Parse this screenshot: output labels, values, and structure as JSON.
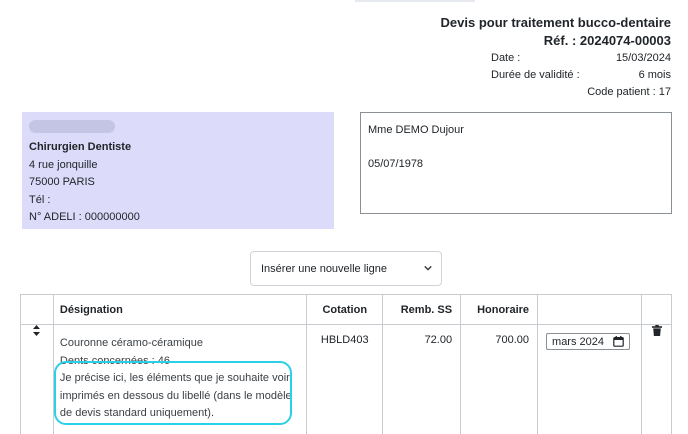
{
  "header": {
    "title": "Devis pour traitement bucco-dentaire",
    "ref": "Réf. : 2024074-00003",
    "date_label": "Date :",
    "date_value": "15/03/2024",
    "validity_label": "Durée de validité :",
    "validity_value": "6 mois",
    "patient_code": "Code patient : 17"
  },
  "practitioner": {
    "title": "Chirurgien Dentiste",
    "address1": "4 rue jonquille",
    "address2": "75000 PARIS",
    "phone": "Tél :",
    "adeli": "N° ADELI : 000000000"
  },
  "patient": {
    "name": "Mme DEMO Dujour",
    "birthdate": "05/07/1978"
  },
  "insert_select": {
    "selected": "Insérer une nouvelle ligne"
  },
  "table": {
    "headers": {
      "designation": "Désignation",
      "cotation": "Cotation",
      "remb": "Remb. SS",
      "honoraire": "Honoraire"
    },
    "rows": [
      {
        "label": "Couronne céramo-céramique",
        "teeth": "Dents concernées : 46",
        "note_1": "Je précise ici, les éléments que je souhaite voir",
        "note_2": "imprimés en dessous du libellé (dans le modèle",
        "note_3": "de devis standard uniquement).",
        "cotation": "HBLD403",
        "remb": "72.00",
        "honoraire": "700.00",
        "date": "mars 2024"
      }
    ]
  },
  "colors": {
    "practitioner_bg": "#dcdcfa",
    "highlight": "#2ad0e6"
  },
  "icons": {
    "sort": "sort-icon",
    "delete": "trash-icon",
    "calendar": "calendar-icon",
    "dropdown": "chevron-down-icon"
  }
}
